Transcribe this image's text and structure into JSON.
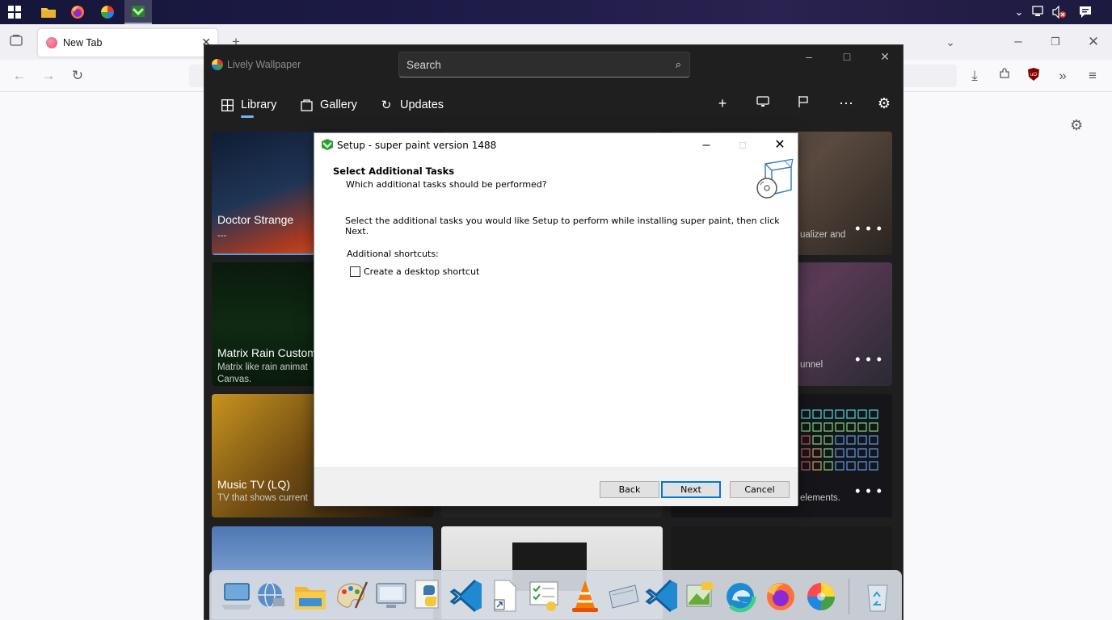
{
  "browser": {
    "tab_label": "New Tab"
  },
  "lively": {
    "title": "Lively Wallpaper",
    "search_placeholder": "Search",
    "nav": {
      "library": "Library",
      "gallery": "Gallery",
      "updates": "Updates"
    },
    "cards": [
      {
        "title": "Doctor Strange",
        "desc": "---"
      },
      {
        "title": "Matrix Rain Custom",
        "desc_line1": "Matrix like rain animat",
        "desc_line2": "Canvas."
      },
      {
        "title": "Music TV (LQ)",
        "desc": "TV that shows current"
      },
      {
        "desc": "ualizer and"
      },
      {
        "desc": "unnel"
      },
      {
        "desc": "elements."
      }
    ],
    "more_label": "• • •"
  },
  "setup": {
    "title": "Setup - super paint version 1488",
    "heading": "Select Additional Tasks",
    "subheading": "Which additional tasks should be performed?",
    "description": "Select the additional tasks you would like Setup to perform while installing super paint, then click Next.",
    "additional_shortcuts": "Additional shortcuts:",
    "checkbox_label": "Create a desktop shortcut",
    "checkbox_checked": false,
    "buttons": {
      "back": "Back",
      "next": "Next",
      "cancel": "Cancel"
    }
  },
  "dock_icons": [
    "computer-icon",
    "network-icon",
    "folder-icon",
    "paint-icon",
    "monitor-icon",
    "python-icon",
    "vscode-icon",
    "file-shortcut-icon",
    "checklist-icon",
    "vlc-icon",
    "drive-icon",
    "vscode-icon",
    "app-icon",
    "edge-icon",
    "firefox-icon",
    "color-wheel-icon",
    "recycle-bin-icon"
  ]
}
